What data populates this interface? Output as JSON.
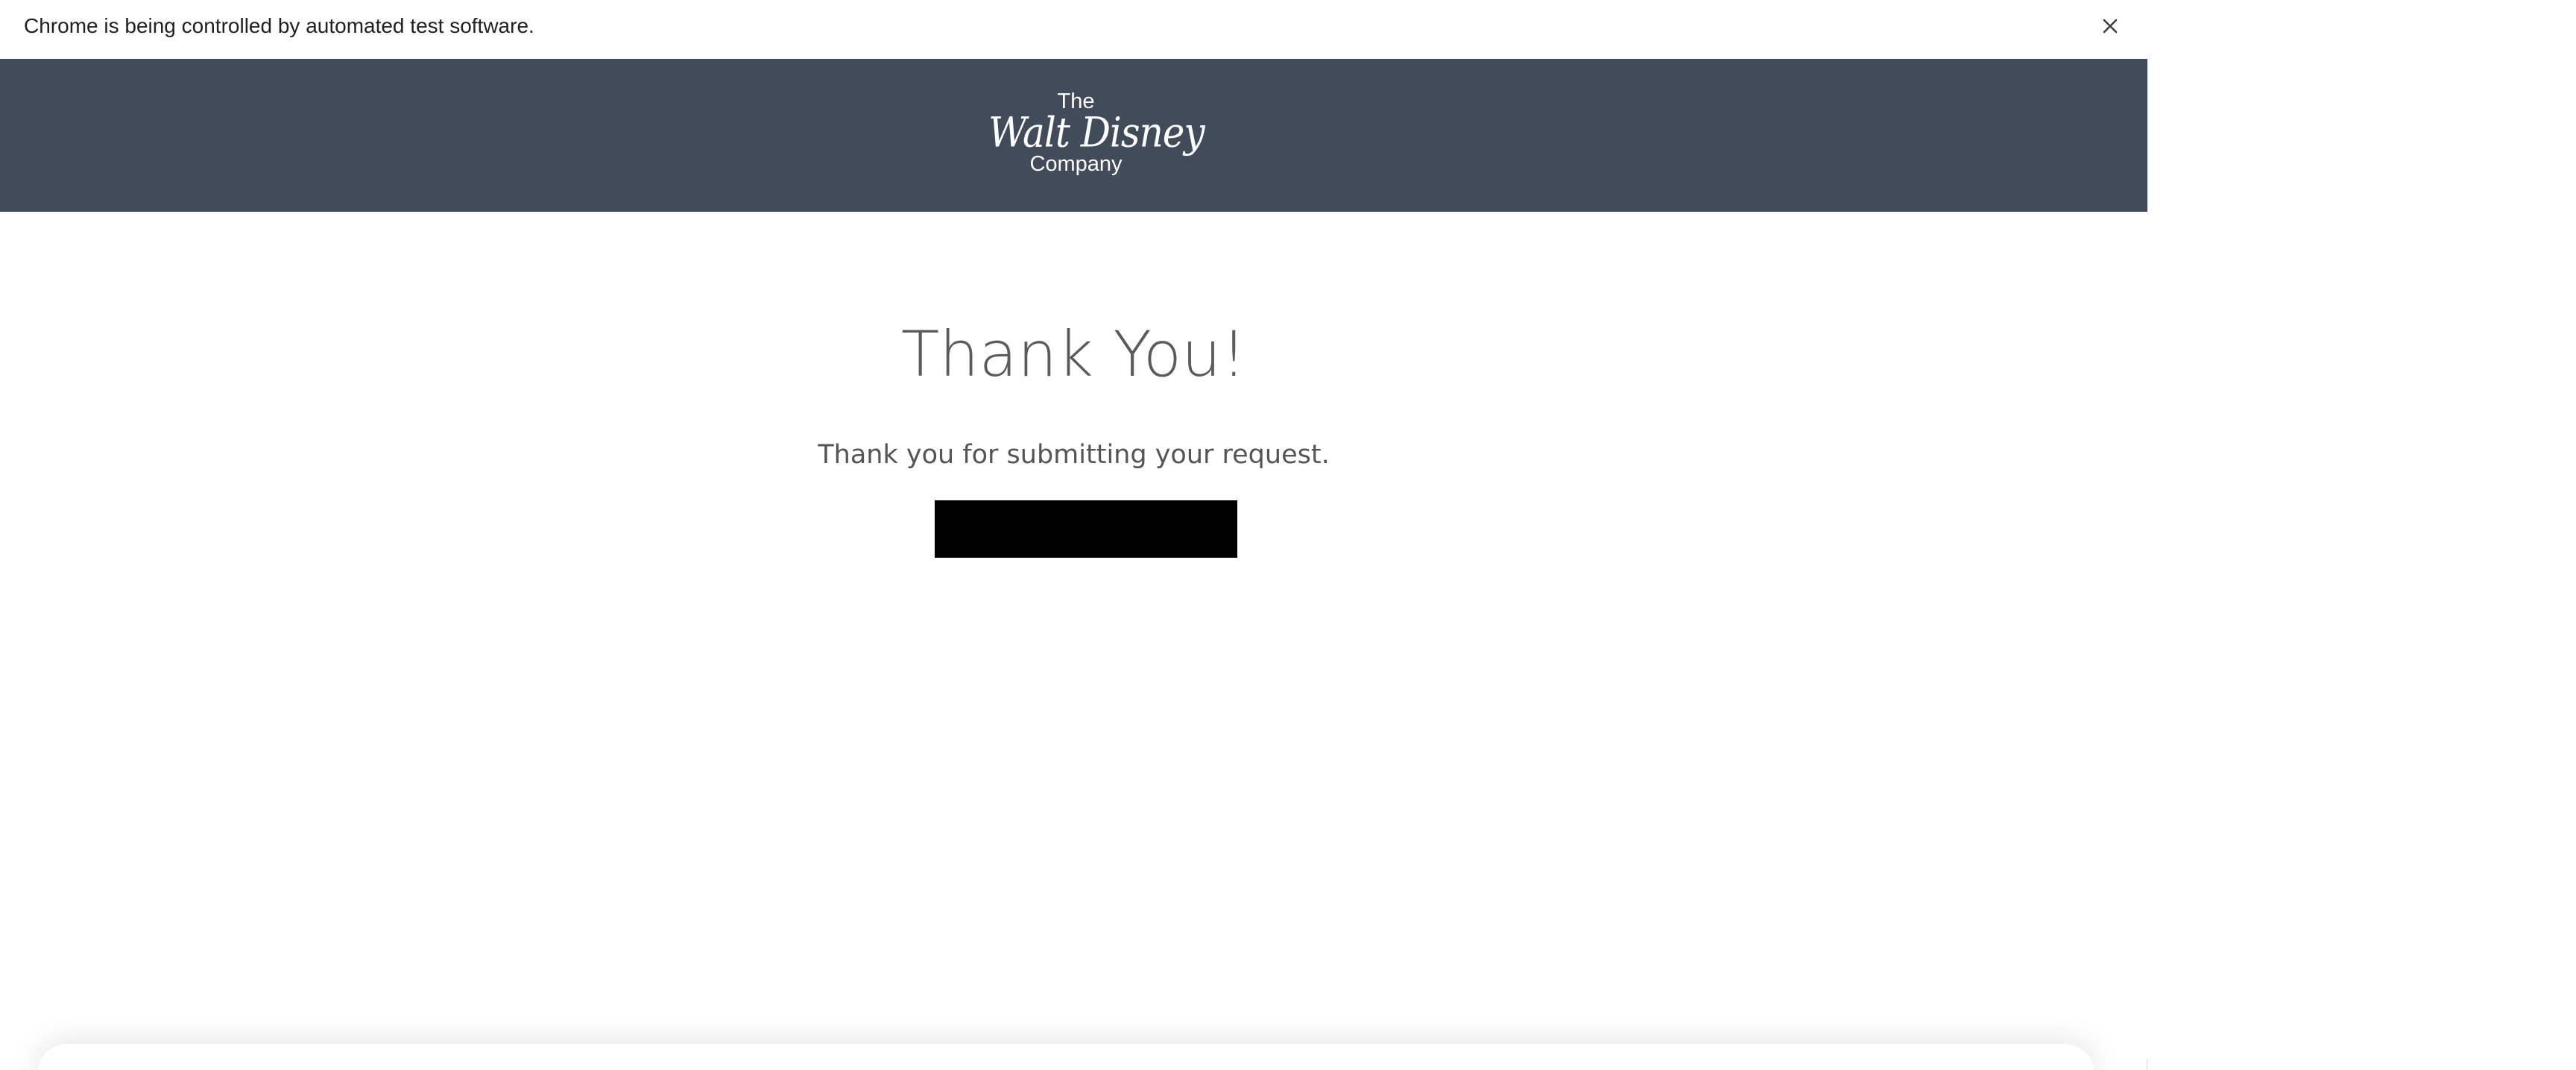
{
  "browser": {
    "infobar_text": "Chrome is being controlled by automated test software.",
    "close_icon": "close-icon"
  },
  "header": {
    "background_color": "#424b5a",
    "logo": {
      "line1": "The",
      "line2": "Walt Disney",
      "line3": "Company"
    }
  },
  "main": {
    "title": "Thank You!",
    "message": "Thank you for submitting your request.",
    "button_label": ""
  },
  "colors": {
    "title_text": "#5b5b5b",
    "body_text": "#555555",
    "button_bg": "#000000"
  }
}
